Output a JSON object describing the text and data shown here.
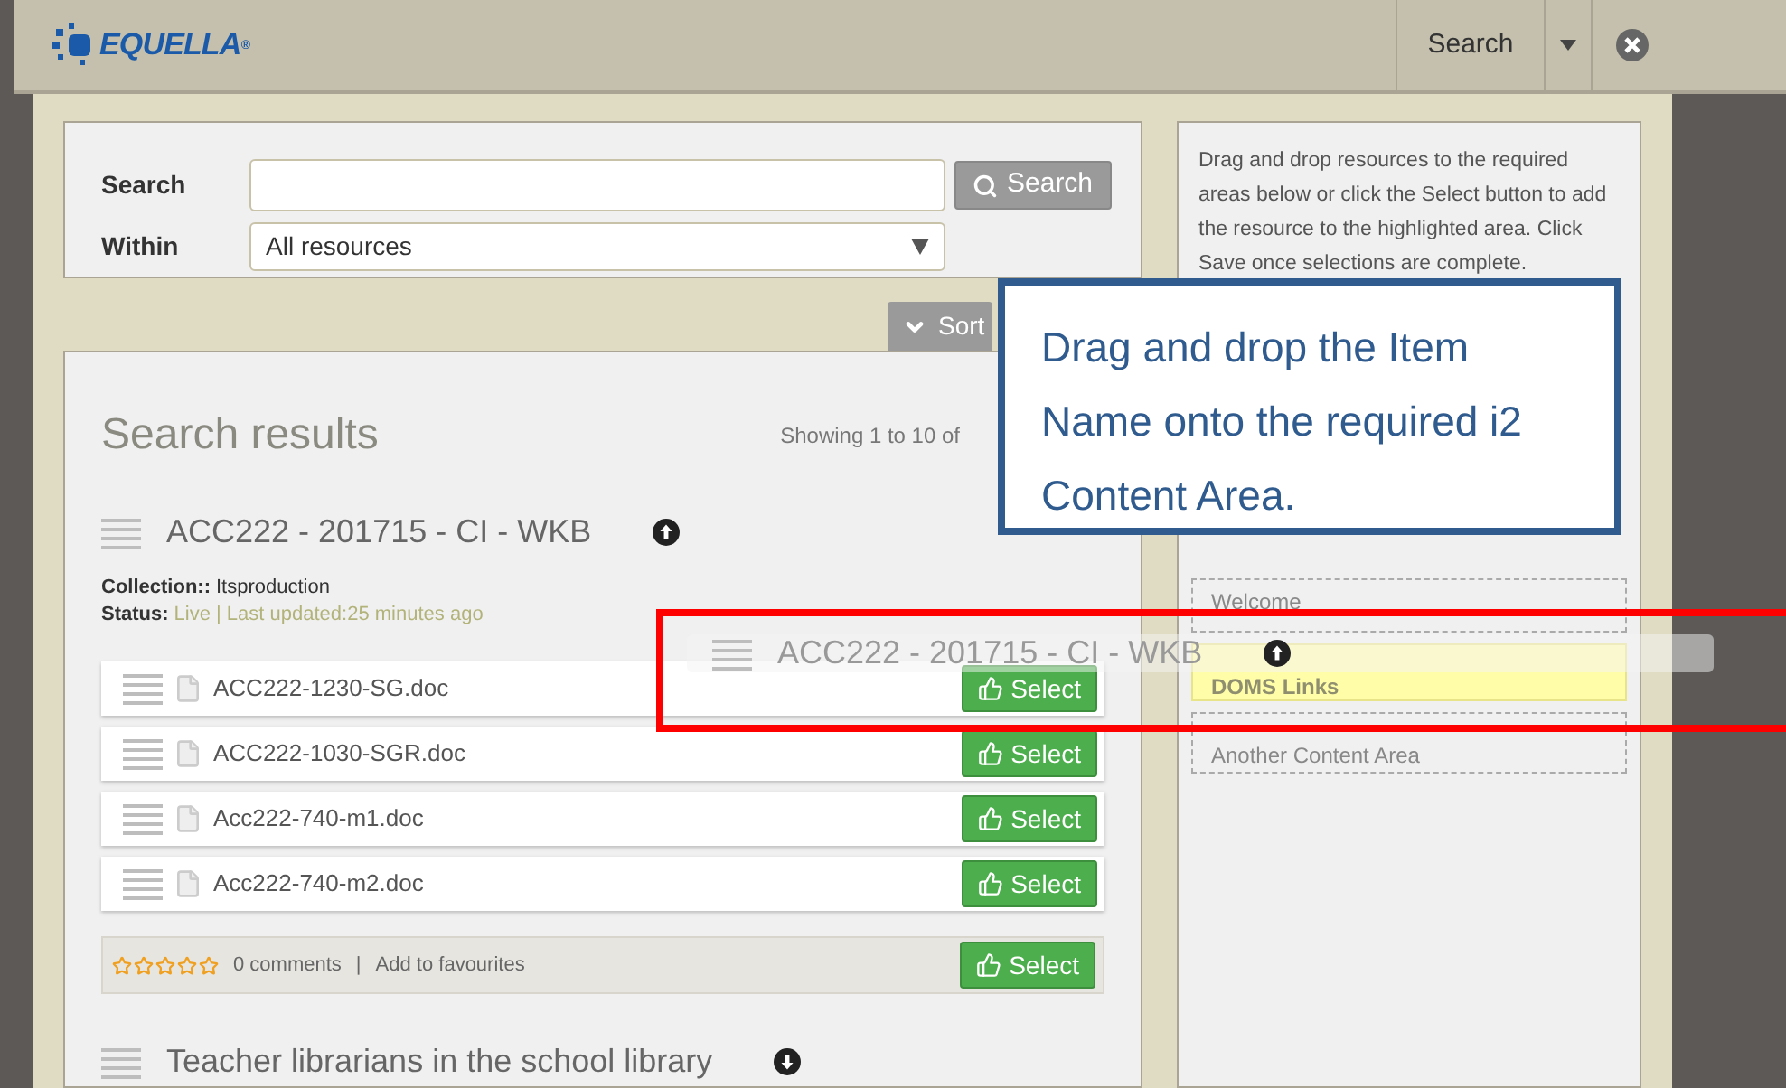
{
  "header": {
    "logo": "EQUELLA",
    "logo_mark": "®",
    "nav_label": "Search"
  },
  "search_form": {
    "search_label": "Search",
    "search_button": "Search",
    "within_label": "Within",
    "within_value": "All resources"
  },
  "sort_button": "Sort",
  "results": {
    "title": "Search results",
    "showing": "Showing 1 to 10 of",
    "items": [
      {
        "title": "ACC222 - 201715 - CI - WKB",
        "expanded": true,
        "collection_label": "Collection::",
        "collection": "Itsproduction",
        "status_label": "Status:",
        "status": "Live | Last updated:25 minutes ago",
        "files": [
          {
            "name": "ACC222-1230-SG.doc",
            "select": "Select"
          },
          {
            "name": "ACC222-1030-SGR.doc",
            "select": "Select"
          },
          {
            "name": "Acc222-740-m1.doc",
            "select": "Select"
          },
          {
            "name": "Acc222-740-m2.doc",
            "select": "Select"
          }
        ],
        "stars": 0,
        "comments": "0 comments",
        "separator": "|",
        "favourites": "Add to favourites",
        "select": "Select"
      },
      {
        "title": "Teacher librarians in the school library",
        "expanded": false
      }
    ]
  },
  "instructions": "Drag and drop resources to the required areas below or click the Select button to add the resource to the highlighted area. Click Save once selections are complete.",
  "drop_areas": [
    {
      "label": "Welcome",
      "highlighted": false
    },
    {
      "label": "DOMS Links",
      "highlighted": true
    },
    {
      "label": "Another Content Area",
      "highlighted": false
    }
  ],
  "dragged_item": {
    "title": "ACC222 - 201715 - CI - WKB"
  },
  "callout": {
    "text": "Drag and drop the Item Name onto the required i2 Content Area."
  }
}
